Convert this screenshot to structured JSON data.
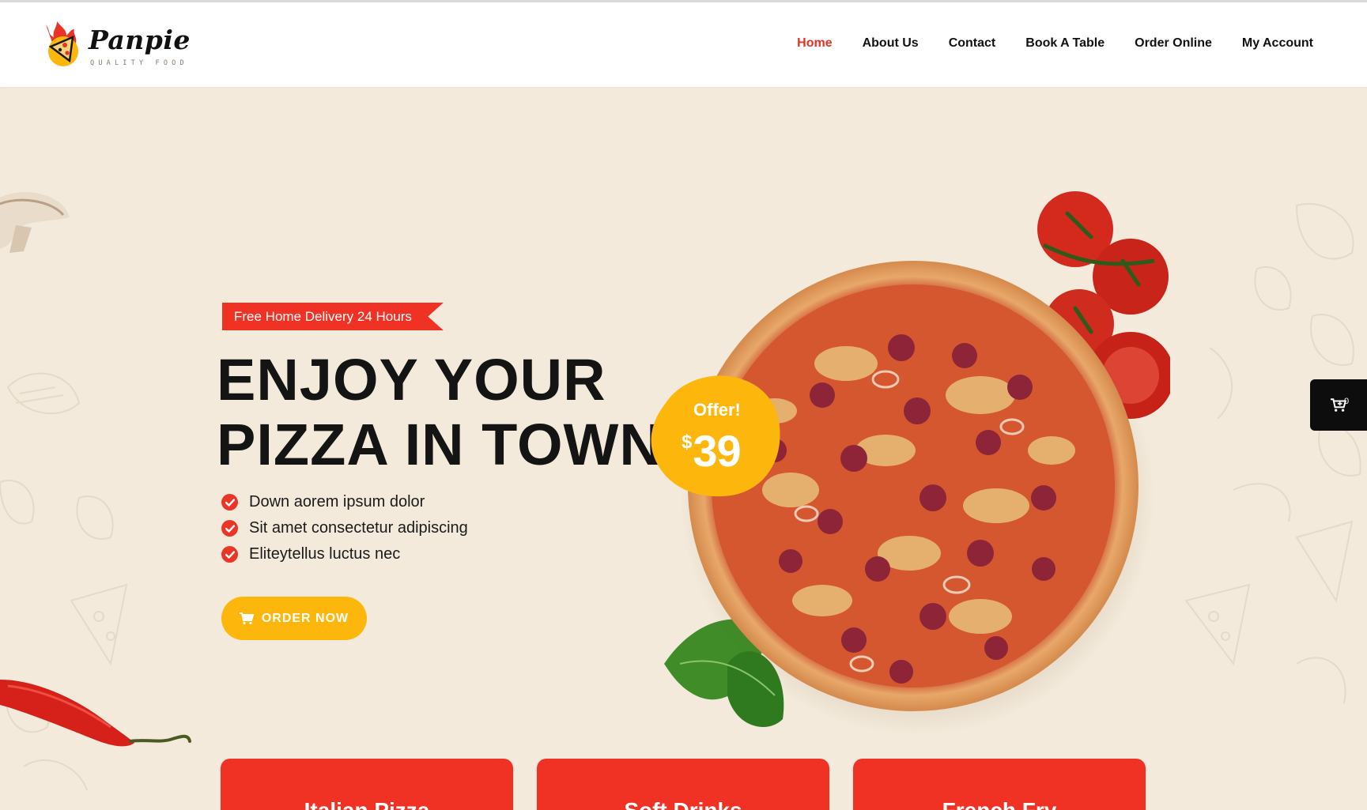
{
  "brand": {
    "name": "Panpie",
    "tagline": "QUALITY FOOD"
  },
  "nav": {
    "items": [
      {
        "label": "Home",
        "active": true
      },
      {
        "label": "About Us",
        "active": false
      },
      {
        "label": "Contact",
        "active": false
      },
      {
        "label": "Book A Table",
        "active": false
      },
      {
        "label": "Order Online",
        "active": false
      },
      {
        "label": "My Account",
        "active": false
      }
    ]
  },
  "hero": {
    "badge": "Free Home Delivery 24 Hours",
    "headline_line1": "ENJOY YOUR",
    "headline_line2": "PIZZA IN TOWN!",
    "features": [
      "Down aorem ipsum dolor",
      "Sit amet consectetur adipiscing",
      "Eliteytellus luctus nec"
    ],
    "cta_label": "ORDER NOW",
    "offer": {
      "label": "Offer!",
      "currency": "$",
      "price": "39"
    }
  },
  "cart": {
    "count": "0"
  },
  "categories": [
    "Italian Pizza",
    "Soft Drinks",
    "French Fry"
  ],
  "colors": {
    "accent_red": "#f03225",
    "accent_yellow": "#fdb60b",
    "background": "#f3eadb",
    "text_dark": "#141414"
  },
  "icons": [
    "flame-pizza-logo-icon",
    "check-circle-icon",
    "cart-icon"
  ]
}
